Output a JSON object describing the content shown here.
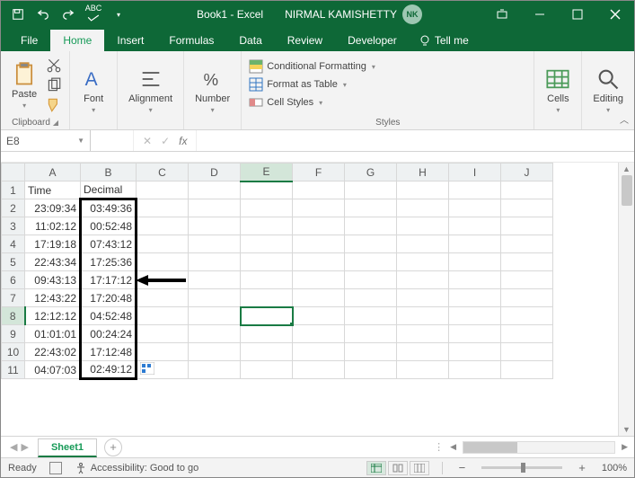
{
  "title": {
    "doc": "Book1 - Excel",
    "user": "NIRMAL KAMISHETTY",
    "badge": "NK"
  },
  "tabs": {
    "file": "File",
    "home": "Home",
    "insert": "Insert",
    "formulas": "Formulas",
    "data": "Data",
    "review": "Review",
    "developer": "Developer",
    "tellme": "Tell me"
  },
  "ribbon": {
    "clipboard": {
      "paste": "Paste",
      "label": "Clipboard"
    },
    "font": {
      "btn": "Font"
    },
    "alignment": {
      "btn": "Alignment"
    },
    "number": {
      "btn": "Number"
    },
    "styles": {
      "cond": "Conditional Formatting",
      "table": "Format as Table",
      "cell": "Cell Styles",
      "label": "Styles"
    },
    "cells": {
      "btn": "Cells"
    },
    "editing": {
      "btn": "Editing"
    }
  },
  "namebox": "E8",
  "columns": [
    "A",
    "B",
    "C",
    "D",
    "E",
    "F",
    "G",
    "H",
    "I",
    "J"
  ],
  "headers": {
    "A": "Time",
    "B": "Decimal"
  },
  "rows": [
    {
      "n": 2,
      "A": "23:09:34",
      "B": "03:49:36"
    },
    {
      "n": 3,
      "A": "11:02:12",
      "B": "00:52:48"
    },
    {
      "n": 4,
      "A": "17:19:18",
      "B": "07:43:12"
    },
    {
      "n": 5,
      "A": "22:43:34",
      "B": "17:25:36"
    },
    {
      "n": 6,
      "A": "09:43:13",
      "B": "17:17:12"
    },
    {
      "n": 7,
      "A": "12:43:22",
      "B": "17:20:48"
    },
    {
      "n": 8,
      "A": "12:12:12",
      "B": "04:52:48"
    },
    {
      "n": 9,
      "A": "01:01:01",
      "B": "00:24:24"
    },
    {
      "n": 10,
      "A": "22:43:02",
      "B": "17:12:48"
    },
    {
      "n": 11,
      "A": "04:07:03",
      "B": "02:49:12"
    }
  ],
  "sheet_tab": "Sheet1",
  "status": {
    "ready": "Ready",
    "access": "Accessibility: Good to go",
    "zoom": "100%"
  }
}
